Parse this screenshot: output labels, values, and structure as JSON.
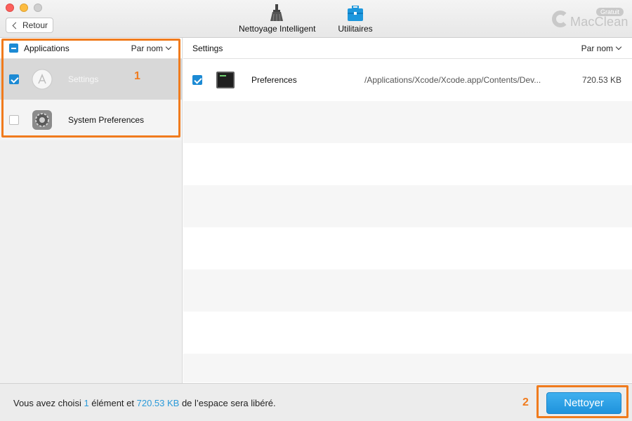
{
  "window": {
    "back_label": "Retour",
    "toolbar": [
      {
        "label": "Nettoyage Intelligent",
        "icon": "broom-icon"
      },
      {
        "label": "Utilitaires",
        "icon": "toolbox-icon"
      }
    ],
    "brand": {
      "name": "MacClean",
      "badge": "Gratuit"
    }
  },
  "left_panel": {
    "title": "Applications",
    "sort_label": "Par nom",
    "items": [
      {
        "name": "Settings",
        "checked": true,
        "selected": true,
        "icon": "app-store-icon"
      },
      {
        "name": "System Preferences",
        "checked": false,
        "selected": false,
        "icon": "gear-icon"
      }
    ]
  },
  "right_panel": {
    "title": "Settings",
    "sort_label": "Par nom",
    "files": [
      {
        "name": "Preferences",
        "path": "/Applications/Xcode/Xcode.app/Contents/Dev...",
        "size": "720.53 KB",
        "checked": true,
        "icon": "terminal-icon"
      }
    ]
  },
  "footer": {
    "summary_prefix": "Vous avez choisi ",
    "summary_count": "1",
    "summary_mid": " élément et ",
    "summary_size": "720.53 KB",
    "summary_suffix": " de l’espace sera libéré.",
    "clean_label": "Nettoyer"
  },
  "annotations": {
    "step1": "1",
    "step2": "2"
  },
  "colors": {
    "accent_blue": "#1c8ad4",
    "highlight_orange": "#f07b1d"
  }
}
